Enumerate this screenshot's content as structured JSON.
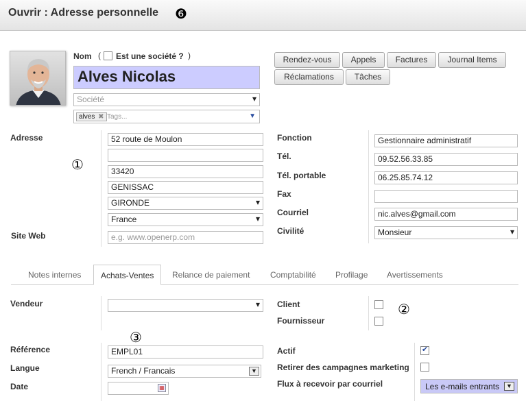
{
  "window": {
    "title": "Ouvrir : Adresse personnelle",
    "marker": "❻"
  },
  "contact": {
    "name_label": "Nom",
    "is_company_open": "(",
    "is_company_label": "Est une société ?",
    "is_company_close": ")",
    "is_company": false,
    "name": "Alves Nicolas",
    "company_placeholder": "Société",
    "tag": "alves",
    "tags_placeholder": "Tags..."
  },
  "buttons": {
    "rendezvous": "Rendez-vous",
    "appels": "Appels",
    "factures": "Factures",
    "journal": "Journal Items",
    "reclamations": "Réclamations",
    "taches": "Tâches"
  },
  "address": {
    "label": "Adresse",
    "street": "52 route de Moulon",
    "street2": "",
    "zip": "33420",
    "city": "GENISSAC",
    "state": "GIRONDE",
    "country": "France",
    "website_label": "Site Web",
    "website_placeholder": "e.g. www.openerp.com"
  },
  "details": {
    "fonction_label": "Fonction",
    "fonction": "Gestionnaire administratif",
    "tel_label": "Tél.",
    "tel": "09.52.56.33.85",
    "mobile_label": "Tél. portable",
    "mobile": "06.25.85.74.12",
    "fax_label": "Fax",
    "fax": "",
    "email_label": "Courriel",
    "email": "nic.alves@gmail.com",
    "civilite_label": "Civilité",
    "civilite": "Monsieur"
  },
  "markers": {
    "one": "①",
    "two": "②",
    "three": "③"
  },
  "tabs": [
    "Notes internes",
    "Achats-Ventes",
    "Relance de paiement",
    "Comptabilité",
    "Profilage",
    "Avertissements"
  ],
  "active_tab": "Achats-Ventes",
  "sales": {
    "vendeur_label": "Vendeur",
    "vendeur": "",
    "client_label": "Client",
    "client": false,
    "fournisseur_label": "Fournisseur",
    "fournisseur": false,
    "reference_label": "Référence",
    "reference": "EMPL01",
    "langue_label": "Langue",
    "langue": "French / Francais",
    "date_label": "Date",
    "date": "",
    "actif_label": "Actif",
    "actif": true,
    "retirer_label": "Retirer des campagnes marketing",
    "retirer": false,
    "flux_label": "Flux à recevoir par courriel",
    "flux": "Les e-mails entrants"
  },
  "colors": {
    "name_bg": "#ccccff",
    "flux_bg": "#c9c9f7",
    "checkbox_check": "#2b4ea0"
  }
}
